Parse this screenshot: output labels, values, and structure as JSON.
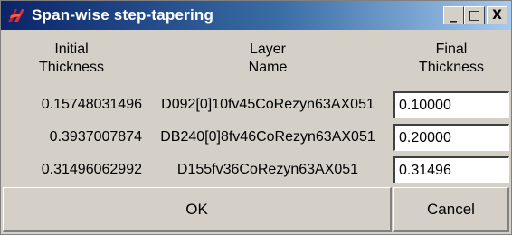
{
  "window": {
    "title": "Span-wise step-tapering",
    "app_icon": "tk-feather-icon",
    "controls": {
      "minimize": "_",
      "maximize": "□",
      "close": "X"
    }
  },
  "headers": {
    "initial": [
      "Initial",
      "Thickness"
    ],
    "layer": [
      "Layer",
      "Name"
    ],
    "final": [
      "Final",
      "Thickness"
    ]
  },
  "rows": [
    {
      "initial": "0.15748031496",
      "layer": "D092[0]10fv45CoRezyn63AX051",
      "final": "0.10000"
    },
    {
      "initial": "0.3937007874",
      "layer": "DB240[0]8fv46CoRezyn63AX051",
      "final": "0.20000"
    },
    {
      "initial": "0.31496062992",
      "layer": "D155fv36CoRezyn63AX051",
      "final": "0.31496"
    }
  ],
  "buttons": {
    "ok": "OK",
    "cancel": "Cancel"
  },
  "colors": {
    "title_start": "#0a246a",
    "title_end": "#a6caf0",
    "face": "#d4d0c8",
    "tk_red": "#c62020"
  }
}
